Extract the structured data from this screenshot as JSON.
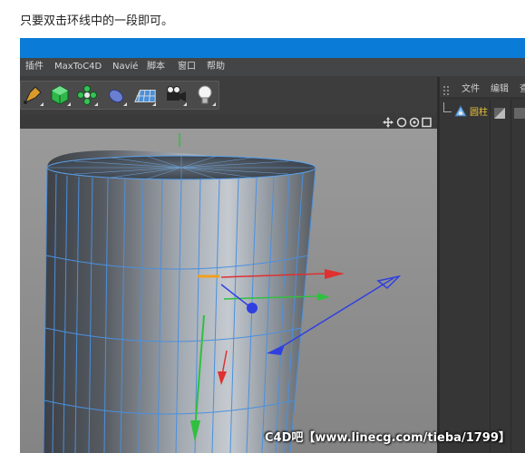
{
  "instruction": "只要双击环线中的一段即可。",
  "menu": [
    "插件",
    "MaxToC4D",
    "Navié",
    "脚本",
    "窗口",
    "帮助"
  ],
  "toolbar": {
    "tools": [
      "pen-tool-icon",
      "cube-icon",
      "cloner-icon",
      "deformer-icon",
      "floor-icon",
      "camera-icon",
      "light-bulb-icon"
    ]
  },
  "viewport": {
    "nav_icons": [
      "move-icon",
      "rotate-icon",
      "zoom-icon",
      "maximize-icon"
    ]
  },
  "object_manager": {
    "tabs": [
      "文件",
      "编辑",
      "查"
    ],
    "objects": [
      {
        "name": "圆柱"
      }
    ]
  },
  "watermark": "C4D吧【www.linecg.com/tieba/1799】",
  "colors": {
    "title_bar": "#0a7bd6",
    "selected_edge": "#f0a020",
    "axis_x": "#e03030",
    "axis_y": "#30c040",
    "axis_z": "#3040e0",
    "object_name": "#e8c23a"
  }
}
